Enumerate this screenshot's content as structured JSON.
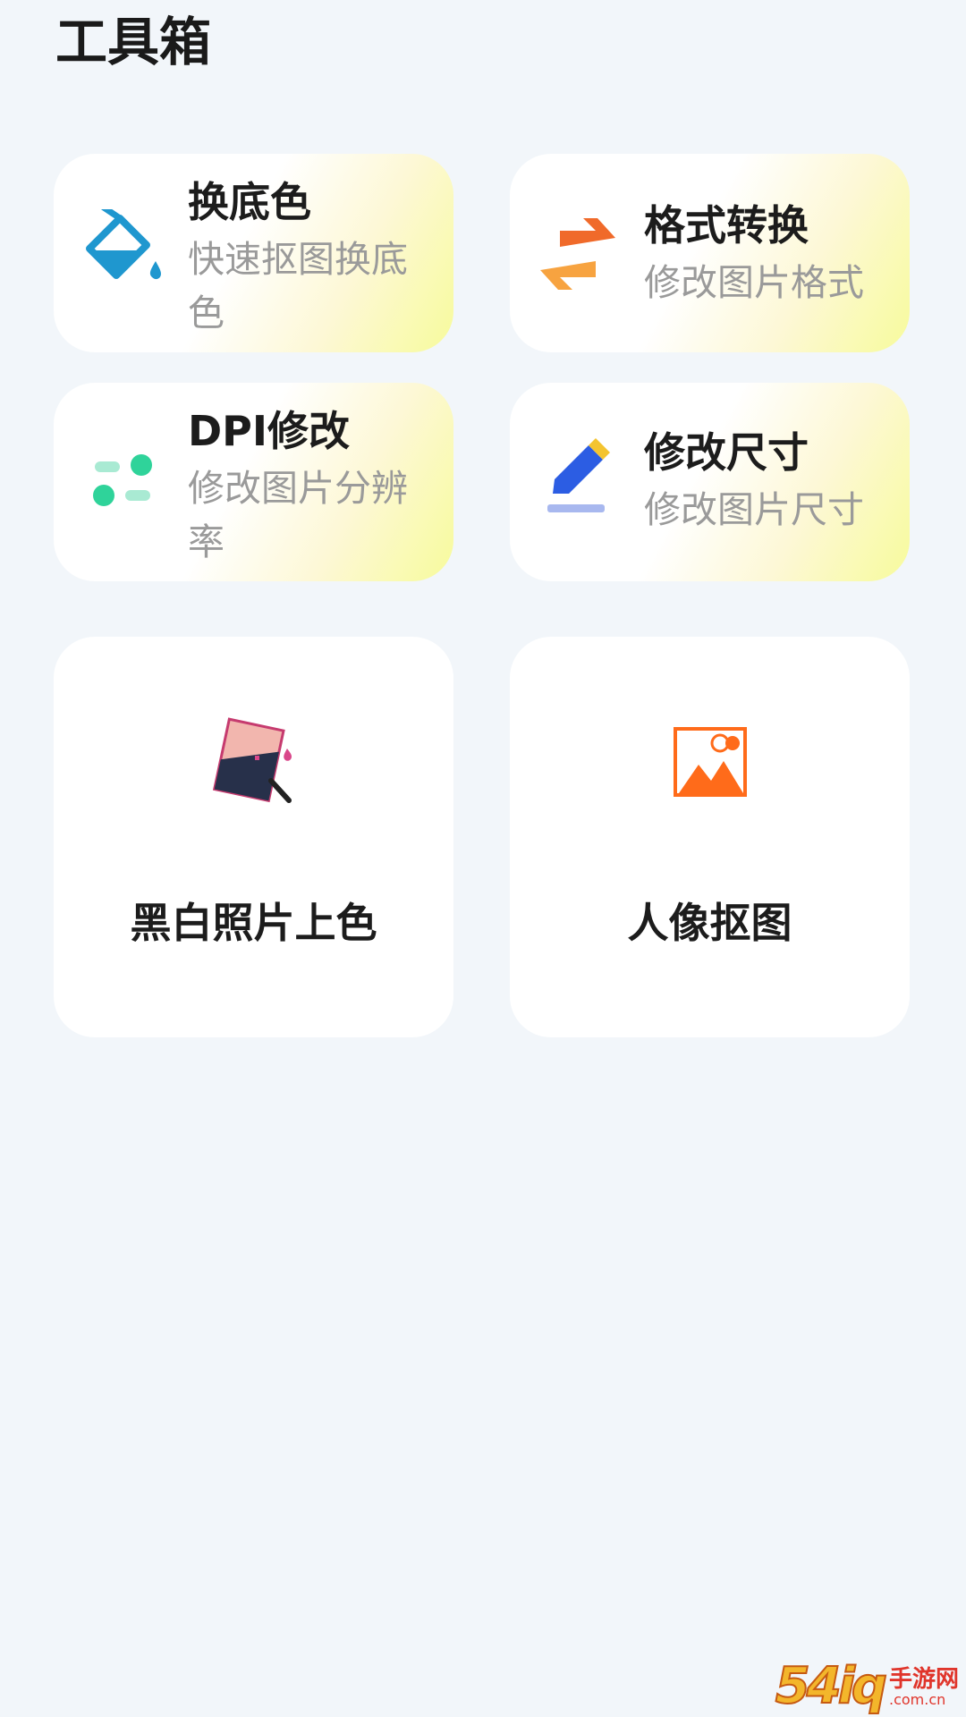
{
  "header": {
    "title": "工具箱"
  },
  "tools": [
    {
      "title": "换底色",
      "desc": "快速抠图换底色",
      "icon": "paint-bucket-icon"
    },
    {
      "title": "格式转换",
      "desc": "修改图片格式",
      "icon": "swap-arrows-icon"
    },
    {
      "title": "DPI修改",
      "desc": "修改图片分辨率",
      "icon": "dpi-adjust-icon"
    },
    {
      "title": "修改尺寸",
      "desc": "修改图片尺寸",
      "icon": "pencil-icon"
    }
  ],
  "features": [
    {
      "title": "黑白照片上色",
      "icon": "photo-colorize-icon"
    },
    {
      "title": "人像抠图",
      "icon": "portrait-cutout-icon"
    }
  ],
  "watermark": {
    "number": "54iq",
    "cn": "手游网",
    "domain": ".com.cn"
  },
  "colors": {
    "background": "#f2f6fa",
    "card_gradient_accent": "#f7fb9c",
    "bucket_blue": "#1f97cf",
    "arrow_orange": "#f06a2a",
    "dot_green": "#2fd39a",
    "pencil_blue": "#2c5de3",
    "photo_orange": "#ff6b1a"
  }
}
